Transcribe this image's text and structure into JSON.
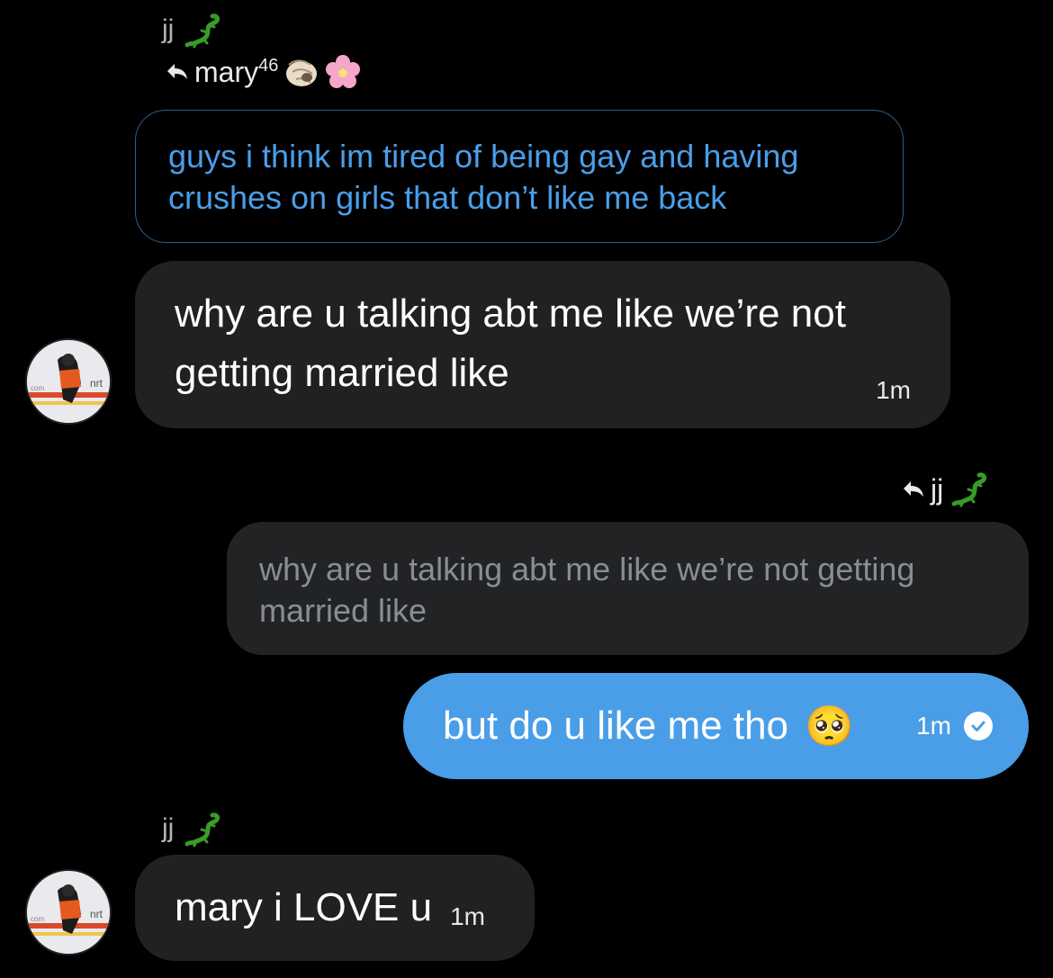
{
  "colors": {
    "background": "#000000",
    "accent_blue": "#4a9ee8",
    "bubble_dark": "#202123",
    "quote_border": "#2f5d8a"
  },
  "messages": {
    "first_group": {
      "sender": "jj",
      "sender_icon": "lizard-icon",
      "reply_to": {
        "name": "mary",
        "superscript": "46",
        "icons": [
          "shell-icon",
          "flower-icon"
        ],
        "quoted_text": "guys i think im tired of being gay and having crushes on girls that don’t like me back"
      },
      "text_line1": "why are u talking abt me like we’re not",
      "text_line2": "getting married like",
      "time": "1m"
    },
    "reply_group": {
      "reply_to": {
        "name": "jj",
        "icon": "lizard-icon",
        "quoted_text_line1": "why are u talking abt me like we’re not getting",
        "quoted_text_line2": "married like"
      },
      "text": "but do u like me tho",
      "emoji": "🥺",
      "time": "1m",
      "status_icon": "read-check-icon"
    },
    "last_group": {
      "sender": "jj",
      "sender_icon": "lizard-icon",
      "text": "mary i LOVE u",
      "time": "1m"
    }
  }
}
